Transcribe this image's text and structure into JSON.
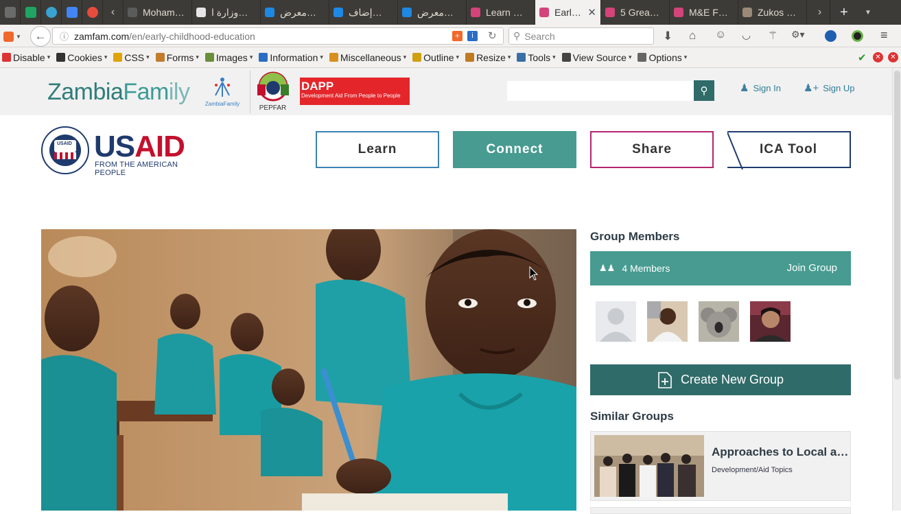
{
  "browser": {
    "tabs": [
      {
        "label": "Mohame…",
        "color": "#5b5b5b"
      },
      {
        "label": "وزارة ا…",
        "color": "#e6e6e6"
      },
      {
        "label": "معرض…",
        "color": "#1e88e5"
      },
      {
        "label": "إضاف…",
        "color": "#1e88e5"
      },
      {
        "label": "معرض…",
        "color": "#1e88e5"
      },
      {
        "label": "Learn …",
        "color": "#d4437a"
      },
      {
        "label": "Earl…",
        "color": "#d4437a",
        "active": true
      },
      {
        "label": "5 Grea…",
        "color": "#d4437a"
      },
      {
        "label": "M&E F…",
        "color": "#d4437a"
      },
      {
        "label": "Zukos …",
        "color": "#9a8a77"
      }
    ],
    "url_domain": "zamfam.com",
    "url_path": "/en/early-childhood-education",
    "search_placeholder": "Search",
    "webdev_toolbar": [
      {
        "label": "Disable",
        "color": "#d33"
      },
      {
        "label": "Cookies",
        "color": "#333"
      },
      {
        "label": "CSS",
        "color": "#e0a400"
      },
      {
        "label": "Forms",
        "color": "#c27c2c"
      },
      {
        "label": "Images",
        "color": "#6a8e3a"
      },
      {
        "label": "Information",
        "color": "#2b6cc4"
      },
      {
        "label": "Miscellaneous",
        "color": "#d88f1e"
      },
      {
        "label": "Outline",
        "color": "#d0a010"
      },
      {
        "label": "Resize",
        "color": "#c07a20"
      },
      {
        "label": "Tools",
        "color": "#3a6ea5"
      },
      {
        "label": "View Source",
        "color": "#444"
      },
      {
        "label": "Options",
        "color": "#666"
      }
    ]
  },
  "site": {
    "brand_a": "Zambia",
    "brand_b": "Fam",
    "brand_c": "ily",
    "zf_small": "ZambiaFamily",
    "pepfar": "PEPFAR",
    "dapp_title": "DAPP",
    "dapp_sub": "Development Aid From People to People",
    "sign_in": "Sign In",
    "sign_up": "Sign Up",
    "usaid_a": "US",
    "usaid_b": "AID",
    "usaid_sub": "FROM THE AMERICAN PEOPLE",
    "usaid_seal": "USAID",
    "nav": {
      "learn": "Learn",
      "connect": "Connect",
      "share": "Share",
      "ica": "ICA Tool"
    }
  },
  "sidebar": {
    "group_members_title": "Group Members",
    "members_count": "4 Members",
    "join_label": "Join Group",
    "create_label": "Create New Group",
    "similar_title": "Similar Groups",
    "similar": [
      {
        "title": "Approaches to Local a…",
        "tag": "Development/Aid Topics"
      }
    ]
  },
  "colors": {
    "teal": "#479b91",
    "dark_teal": "#2f6b69",
    "usaid_blue": "#1f3a6d",
    "usaid_red": "#c4102e"
  }
}
